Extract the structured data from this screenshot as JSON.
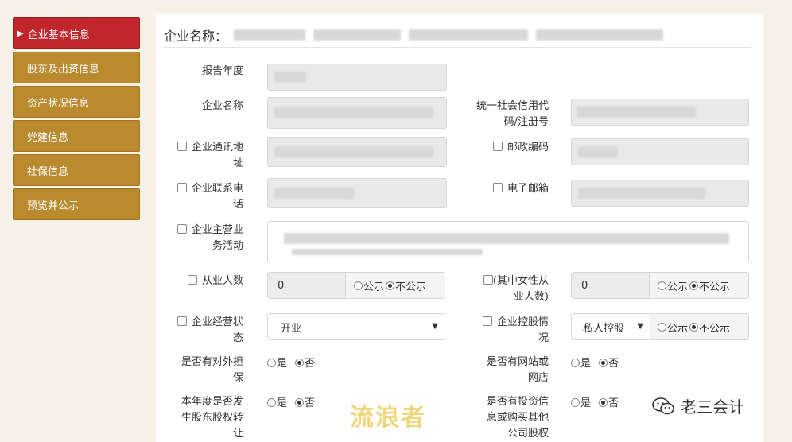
{
  "sidebar": {
    "items": [
      {
        "label": "企业基本信息"
      },
      {
        "label": "股东及出资信息"
      },
      {
        "label": "资产状况信息"
      },
      {
        "label": "党建信息"
      },
      {
        "label": "社保信息"
      },
      {
        "label": "预览并公示"
      }
    ]
  },
  "header": {
    "title": "企业名称："
  },
  "form": {
    "report_year": "报告年度",
    "company_name": "企业名称",
    "credit_code": "统一社会信用代码/注册号",
    "address_l1": "企业通讯地",
    "address_l2": "址",
    "postal": "邮政编码",
    "phone_l1": "企业联系电",
    "phone_l2": "话",
    "email": "电子邮箱",
    "business_l1": "企业主营业",
    "business_l2": "务活动",
    "employees": "从业人数",
    "employees_value": "0",
    "female_l1": "(其中女性从",
    "female_l2": "业人数)",
    "female_value": "0",
    "public": "公示",
    "not_public": "不公示",
    "status_l1": "企业经营状",
    "status_l2": "态",
    "status_value": "开业",
    "holding_l1": "企业控股情",
    "holding_l2": "况",
    "holding_value": "私人控股",
    "guarantee_l1": "是否有对外担",
    "guarantee_l2": "保",
    "website_l1": "是否有网站或",
    "website_l2": "网店",
    "transfer_l1": "本年度是否发",
    "transfer_l2": "生股东股权转",
    "transfer_l3": "让",
    "invest_l1": "是否有投资信",
    "invest_l2": "息或购买其他",
    "invest_l3": "公司股权",
    "yes": "是",
    "no": "否"
  },
  "watermark": "流浪者",
  "logo": "老三会计"
}
